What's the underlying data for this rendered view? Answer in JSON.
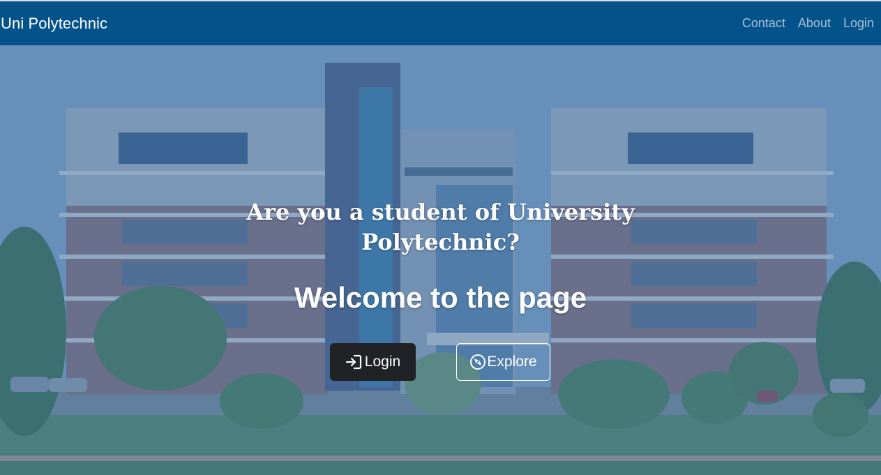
{
  "navbar": {
    "brand": "Uni Polytechnic",
    "links": [
      {
        "label": "Contact"
      },
      {
        "label": "About"
      },
      {
        "label": "Login"
      }
    ]
  },
  "hero": {
    "question": "Are you a student of University Polytechnic?",
    "title": "Welcome to the page",
    "buttons": {
      "login": {
        "label": "Login",
        "icon": "login-arrow-icon"
      },
      "explore": {
        "label": "Explore",
        "icon": "compass-icon"
      }
    },
    "background_image": "campus-building-photo"
  },
  "colors": {
    "navbar_bg": "#03528a",
    "nav_link": "#a9c1d6",
    "login_button_bg": "#202226",
    "text": "#ffffff"
  }
}
